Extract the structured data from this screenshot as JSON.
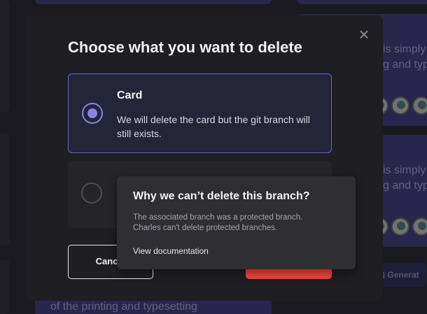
{
  "background": {
    "card_snippets": [
      "is simply",
      "g and typ",
      "is simply",
      "g and typ"
    ],
    "bottom_text": "of the printing and typesetting",
    "generate_label": "Generat"
  },
  "modal": {
    "title": "Choose what you want to delete",
    "close_glyph": "×",
    "options": [
      {
        "title": "Card",
        "description": "We will delete the card but the git branch will still exists.",
        "selected": true
      },
      {
        "selected": false,
        "disabled": true
      }
    ],
    "cancel_label": "Cancel"
  },
  "tooltip": {
    "title": "Why we can’t delete this  branch?",
    "body_line1": "The associated branch was a protected branch.",
    "body_line2": "Charles can't delete protected branches.",
    "link_label": "View documentation"
  },
  "colors": {
    "accent": "#8583e4",
    "danger": "#f0433b",
    "modal_bg": "#1e1e23",
    "tooltip_bg": "#2e2e33"
  }
}
